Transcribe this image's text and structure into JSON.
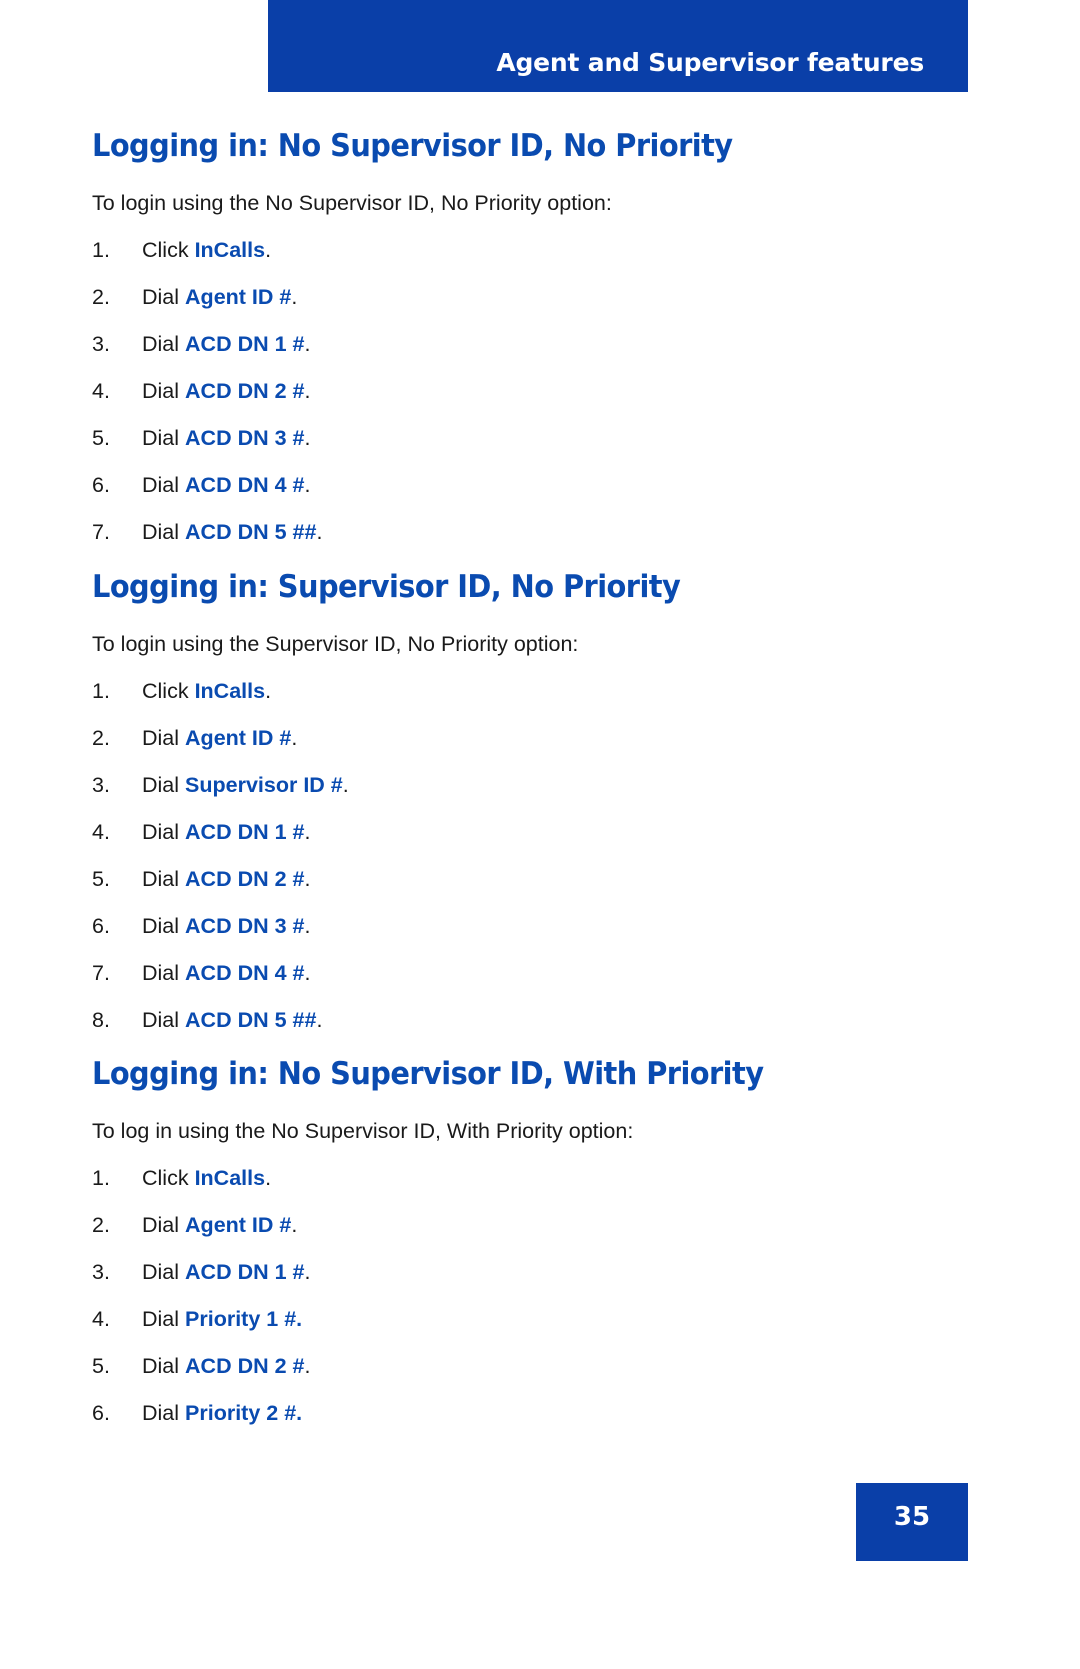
{
  "page": {
    "header_title": "Agent and Supervisor features",
    "page_number": "35",
    "accent_blue": "#0A3FA8",
    "heading_blue": "#0A4BB0",
    "body_black": "#1a1a1a"
  },
  "sections": [
    {
      "heading": "Logging in: No Supervisor ID, No Priority",
      "intro": "To login using the No Supervisor ID, No Priority option:",
      "steps": [
        {
          "number": "1.",
          "verb": "Click",
          "term": "InCalls",
          "period": ".",
          "period_blue": false
        },
        {
          "number": "2.",
          "verb": "Dial",
          "term": "Agent ID #",
          "period": ".",
          "period_blue": false
        },
        {
          "number": "3.",
          "verb": "Dial",
          "term": "ACD DN 1 #",
          "period": ".",
          "period_blue": false
        },
        {
          "number": "4.",
          "verb": "Dial",
          "term": "ACD DN 2 #",
          "period": ".",
          "period_blue": false
        },
        {
          "number": "5.",
          "verb": "Dial",
          "term": "ACD DN 3 #",
          "period": ".",
          "period_blue": false
        },
        {
          "number": "6.",
          "verb": "Dial",
          "term": "ACD DN 4 #",
          "period": ".",
          "period_blue": false
        },
        {
          "number": "7.",
          "verb": "Dial",
          "term": "ACD DN 5 ##",
          "period": ".",
          "period_blue": false
        }
      ]
    },
    {
      "heading": "Logging in: Supervisor ID, No Priority",
      "intro": "To login using the Supervisor ID, No Priority option:",
      "steps": [
        {
          "number": "1.",
          "verb": "Click",
          "term": "InCalls",
          "period": ".",
          "period_blue": false
        },
        {
          "number": "2.",
          "verb": "Dial",
          "term": "Agent ID #",
          "period": ".",
          "period_blue": false
        },
        {
          "number": "3.",
          "verb": "Dial",
          "term": "Supervisor ID #",
          "period": ".",
          "period_blue": false
        },
        {
          "number": "4.",
          "verb": "Dial",
          "term": "ACD DN 1 #",
          "period": ".",
          "period_blue": false
        },
        {
          "number": "5.",
          "verb": "Dial",
          "term": "ACD DN 2 #",
          "period": ".",
          "period_blue": false
        },
        {
          "number": "6.",
          "verb": "Dial",
          "term": "ACD DN 3 #",
          "period": ".",
          "period_blue": false
        },
        {
          "number": "7.",
          "verb": "Dial",
          "term": "ACD DN 4 #",
          "period": ".",
          "period_blue": false
        },
        {
          "number": "8.",
          "verb": "Dial",
          "term": "ACD DN 5 ##",
          "period": ".",
          "period_blue": false
        }
      ]
    },
    {
      "heading": "Logging in: No Supervisor ID, With Priority",
      "intro": "To log in using the No Supervisor ID, With Priority option:",
      "steps": [
        {
          "number": "1.",
          "verb": "Click",
          "term": "InCalls",
          "period": ".",
          "period_blue": false
        },
        {
          "number": "2.",
          "verb": "Dial",
          "term": "Agent ID #",
          "period": ".",
          "period_blue": false
        },
        {
          "number": "3.",
          "verb": "Dial",
          "term": "ACD DN 1 #",
          "period": ".",
          "period_blue": false
        },
        {
          "number": "4.",
          "verb": "Dial",
          "term": "Priority 1 #.",
          "period": "",
          "period_blue": true
        },
        {
          "number": "5.",
          "verb": "Dial",
          "term": "ACD DN 2 #",
          "period": ".",
          "period_blue": false
        },
        {
          "number": "6.",
          "verb": "Dial",
          "term": "Priority 2 #.",
          "period": "",
          "period_blue": true
        }
      ]
    }
  ]
}
